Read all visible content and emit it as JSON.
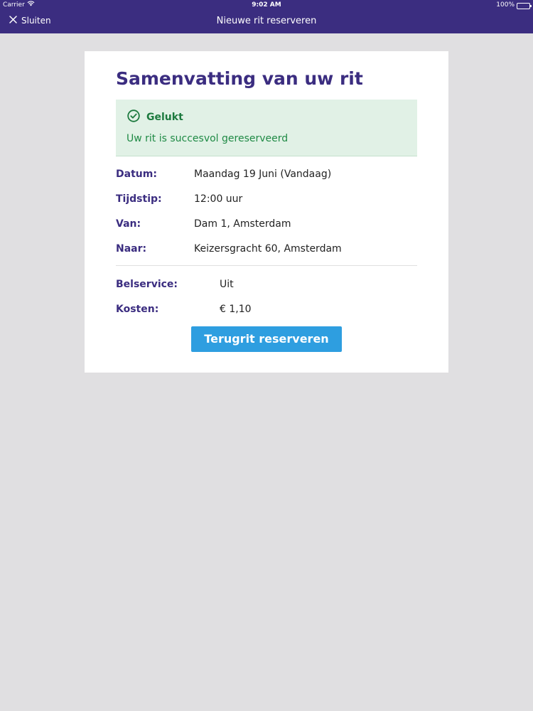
{
  "statusbar": {
    "carrier": "Carrier",
    "time": "9:02 AM",
    "battery": "100%"
  },
  "navbar": {
    "close_label": "Sluiten",
    "title": "Nieuwe rit reserveren"
  },
  "summary": {
    "title": "Samenvatting van uw rit",
    "success": {
      "heading": "Gelukt",
      "message": "Uw rit is succesvol gereserveerd"
    },
    "details": [
      {
        "label": "Datum:",
        "value": "Maandag 19 Juni (Vandaag)"
      },
      {
        "label": "Tijdstip:",
        "value": "12:00 uur"
      },
      {
        "label": "Van:",
        "value": "Dam 1, Amsterdam"
      },
      {
        "label": "Naar:",
        "value": "Keizersgracht 60, Amsterdam"
      }
    ],
    "extras": [
      {
        "label": "Belservice:",
        "value": "Uit"
      },
      {
        "label": "Kosten:",
        "value": "€ 1,10"
      }
    ],
    "return_button": "Terugrit reserveren"
  },
  "colors": {
    "brand": "#3b2d80",
    "success_bg": "#e1f1e6",
    "success_text": "#1d7a3f",
    "button": "#2e9ee0",
    "background": "#e0dfe1"
  }
}
